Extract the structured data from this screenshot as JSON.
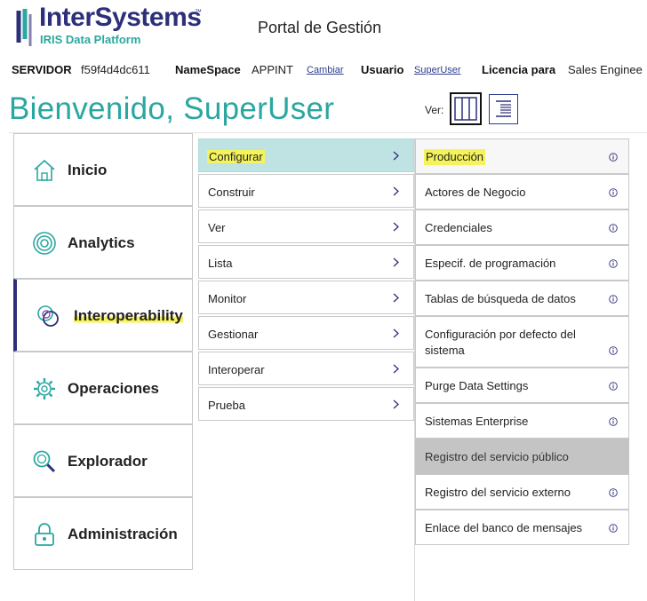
{
  "header": {
    "logo_title": "InterSystems",
    "logo_tm": "™",
    "logo_subtitle": "IRIS Data Platform",
    "portal_title": "Portal de Gestión"
  },
  "infobar": {
    "server_label": "SERVIDOR",
    "server_value": "f59f4d4dc611",
    "namespace_label": "NameSpace",
    "namespace_value": "APPINT",
    "change_link": "Cambiar",
    "user_label": "Usuario",
    "user_link": "SuperUser",
    "license_label": "Licencia para",
    "license_value": "Sales Enginee"
  },
  "welcome": "Bienvenido, SuperUser",
  "view": {
    "label": "Ver:",
    "selected": "columns"
  },
  "nav": [
    {
      "label": "Inicio",
      "icon": "home-icon"
    },
    {
      "label": "Analytics",
      "icon": "analytics-icon"
    },
    {
      "label": "Interoperability",
      "icon": "interoperability-icon",
      "active": true
    },
    {
      "label": "Operaciones",
      "icon": "gear-icon"
    },
    {
      "label": "Explorador",
      "icon": "magnifier-icon"
    },
    {
      "label": "Administración",
      "icon": "lock-icon"
    }
  ],
  "submenu": [
    {
      "label": "Configurar",
      "selected": true
    },
    {
      "label": "Construir"
    },
    {
      "label": "Ver"
    },
    {
      "label": "Lista"
    },
    {
      "label": "Monitor"
    },
    {
      "label": "Gestionar"
    },
    {
      "label": "Interoperar"
    },
    {
      "label": "Prueba"
    }
  ],
  "options": [
    {
      "label": "Producción"
    },
    {
      "label": "Actores de Negocio"
    },
    {
      "label": "Credenciales"
    },
    {
      "label": "Especif. de programación"
    },
    {
      "label": "Tablas de búsqueda de datos"
    },
    {
      "label_line1": "Configuración por defecto del",
      "label_line2": "sistema"
    },
    {
      "label": "Purge Data Settings"
    },
    {
      "label": "Sistemas Enterprise"
    },
    {
      "label": "Registro del servicio público",
      "disabled": true
    },
    {
      "label": "Registro del servicio externo"
    },
    {
      "label": "Enlace del banco de mensajes"
    }
  ],
  "colors": {
    "brand_navy": "#2d2f7a",
    "brand_teal": "#2aa7a0",
    "selected_bg": "#bfe3e3",
    "highlight": "#f4f35c"
  }
}
